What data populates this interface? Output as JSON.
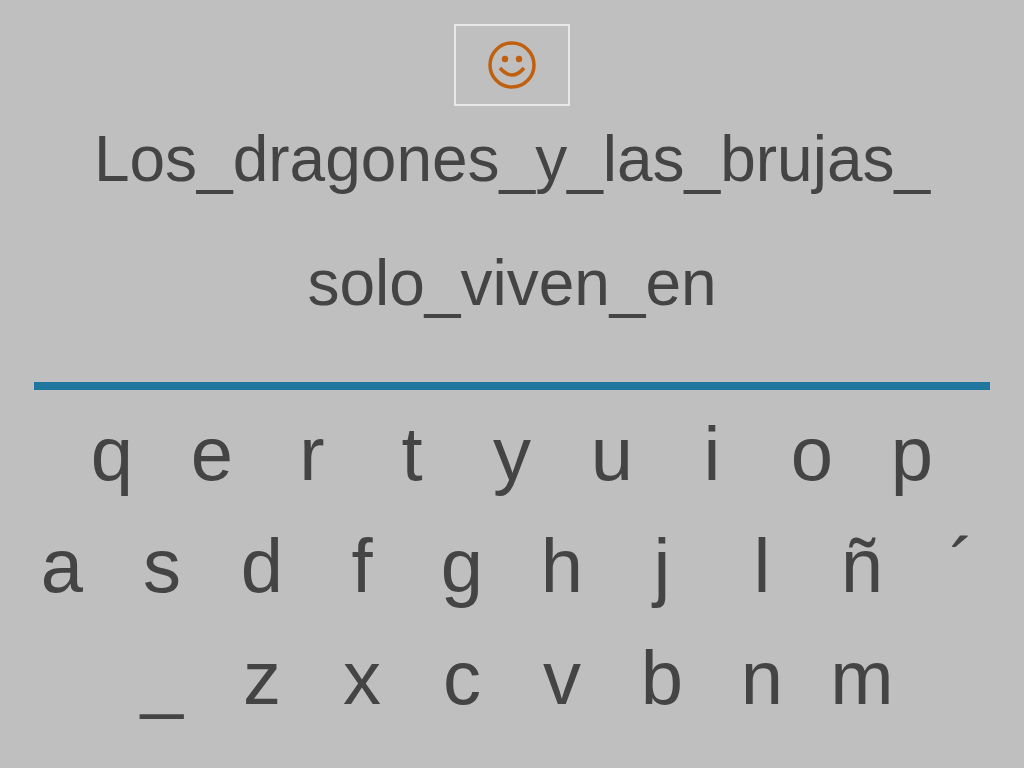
{
  "prompt_lines": [
    "Los_dragones_y_las_brujas_",
    "solo_viven_en"
  ],
  "keyboard_rows": [
    [
      "q",
      "e",
      "r",
      "t",
      "y",
      "u",
      "i",
      "o",
      "p"
    ],
    [
      "a",
      "s",
      "d",
      "f",
      "g",
      "h",
      "j",
      "l",
      "ñ",
      "´"
    ],
    [
      "_",
      "z",
      "x",
      "c",
      "v",
      "b",
      "n",
      "m"
    ]
  ]
}
